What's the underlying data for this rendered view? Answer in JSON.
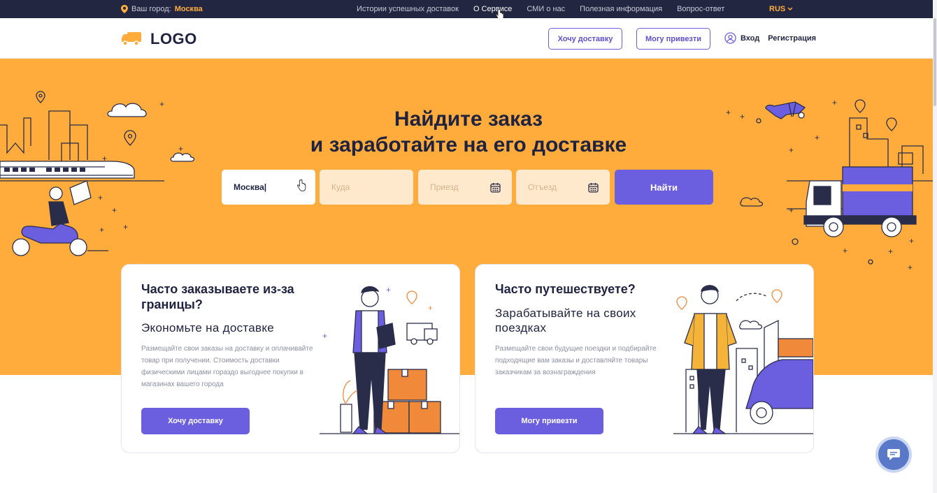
{
  "topbar": {
    "city_label": "Ваш город:",
    "city_value": "Москва",
    "nav": [
      "Истории успешных доставок",
      "О Сервисе",
      "СМИ о нас",
      "Полезная информация",
      "Вопрос-ответ"
    ],
    "active_nav": "О Сервисе",
    "lang": "RUS"
  },
  "header": {
    "logo_text": "LOGO",
    "want_delivery": "Хочу доставку",
    "can_bring": "Могу привезти",
    "login": "Вход",
    "register": "Регистрация"
  },
  "hero": {
    "title_line1": "Найдите заказ",
    "title_line2": "и заработайте на его доставке",
    "from_value": "Москва|",
    "to_placeholder": "Куда",
    "arrival_placeholder": "Приезд",
    "departure_placeholder": "Отъезд",
    "find_button": "Найти"
  },
  "cards": {
    "left": {
      "title": "Часто заказываете из-за границы?",
      "subtitle": "Экономьте на доставке",
      "text": "Размещайте свои заказы на доставку и оплачивайте товар при получении. Стоимость доставки физическими лицами гораздо выгоднее покупки в магазинах вашего города",
      "button": "Хочу доставку"
    },
    "right": {
      "title": "Часто путешествуете?",
      "subtitle": "Зарабатывайте на своих поездках",
      "text": "Размещайте свои будущие поездки и подбирайте подходящие вам заказы и доставляйте товары заказчикам за вознаграждения",
      "button": "Могу привезти"
    }
  },
  "colors": {
    "accent": "#6b5fe0",
    "orange": "#ffac3d",
    "dark": "#222640"
  },
  "icons": [
    "location-pin-icon",
    "chevron-down-icon",
    "truck-logo-icon",
    "user-icon",
    "calendar-icon",
    "chat-icon"
  ]
}
